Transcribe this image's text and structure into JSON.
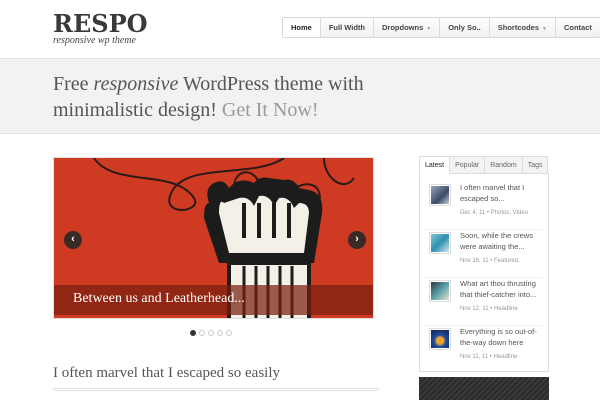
{
  "logo": {
    "title": "RESPO",
    "subtitle": "responsive wp theme"
  },
  "nav": {
    "items": [
      {
        "label": "Home"
      },
      {
        "label": "Full Width"
      },
      {
        "label": "Dropdowns"
      },
      {
        "label": "Only So.."
      },
      {
        "label": "Shortcodes"
      },
      {
        "label": "Contact"
      }
    ]
  },
  "banner": {
    "text_1": "Free ",
    "text_em": "responsive",
    "text_2": " WordPress theme with minimalistic design! ",
    "cta": "Get It Now!"
  },
  "slider": {
    "caption": "Between us and Leatherhead...",
    "prev_icon": "chevron-left-icon",
    "next_icon": "chevron-right-icon",
    "slide_count": 5,
    "active_slide": 1
  },
  "post": {
    "title": "I often marvel that I escaped so easily"
  },
  "sidebar": {
    "tabs": [
      {
        "label": "Latest"
      },
      {
        "label": "Popular"
      },
      {
        "label": "Random"
      },
      {
        "label": "Tags"
      }
    ],
    "posts": [
      {
        "title": "I often marvel that I escaped so...",
        "meta": "Dec 4, 11 • Photos, Video"
      },
      {
        "title": "Soon, while the crews were awaiting the...",
        "meta": "Nov 16, 11 • Featured,"
      },
      {
        "title": "What art thou thrusting that thief-catcher into...",
        "meta": "Nov 12, 11 • Headline"
      },
      {
        "title": "Everything is so out-of-the-way down here",
        "meta": "Nov 11, 11 • Headline"
      }
    ]
  },
  "colors": {
    "slider_bg": "#cf3a22",
    "banner_bg": "#f2f2f2"
  }
}
